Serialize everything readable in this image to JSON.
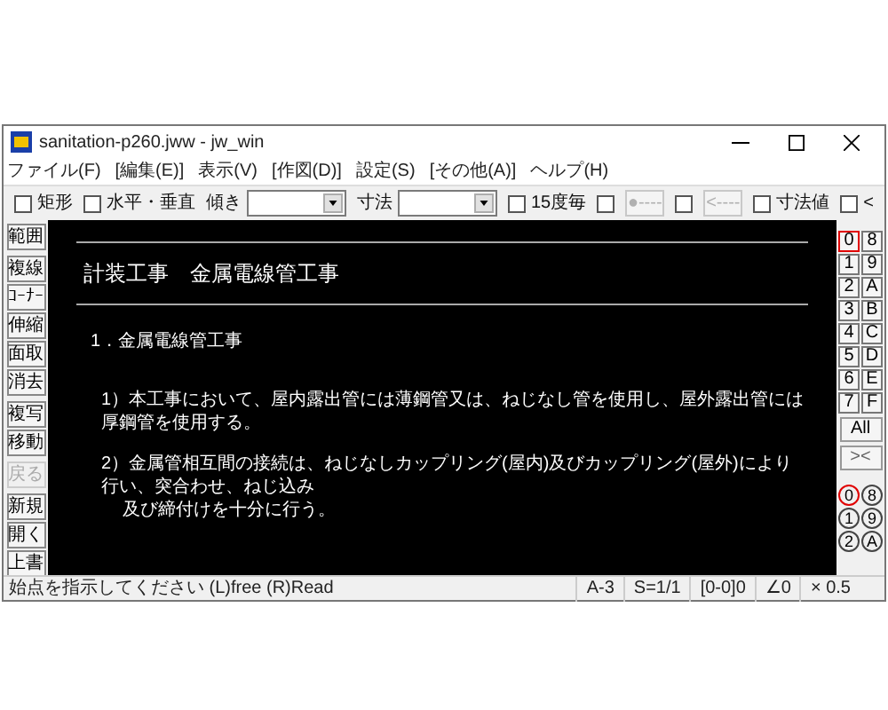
{
  "window": {
    "title": "sanitation-p260.jww - jw_win"
  },
  "menu": [
    "ファイル(F)",
    "[編集(E)]",
    "表示(V)",
    "[作図(D)]",
    "設定(S)",
    "[その他(A)]",
    "ヘルプ(H)"
  ],
  "toolbar": [
    {
      "kind": "checkbox",
      "label": "矩形",
      "checked": false
    },
    {
      "kind": "checkbox",
      "label": "水平・垂直",
      "checked": false
    },
    {
      "kind": "select",
      "label": "傾き"
    },
    {
      "kind": "select",
      "label": "寸法"
    },
    {
      "kind": "checkbox",
      "label": "15度毎",
      "checked": false
    },
    {
      "kind": "checkbox",
      "checked": false
    },
    {
      "kind": "button",
      "label": "●----",
      "disabled": true
    },
    {
      "kind": "checkbox",
      "checked": false
    },
    {
      "kind": "button",
      "label": "<----",
      "disabled": true
    },
    {
      "kind": "checkbox",
      "label": "寸法値",
      "checked": false
    },
    {
      "kind": "checkbox",
      "label": "<",
      "checked": false
    }
  ],
  "left_toolbar": [
    {
      "buttons": [
        {
          "label": "範囲",
          "disabled": false
        }
      ]
    },
    {
      "buttons": [
        {
          "label": "複線",
          "disabled": false
        },
        {
          "label": "ｺｰﾅｰ",
          "disabled": false
        },
        {
          "label": "伸縮",
          "disabled": false
        },
        {
          "label": "面取",
          "disabled": false
        },
        {
          "label": "消去",
          "disabled": false
        }
      ]
    },
    {
      "buttons": [
        {
          "label": "複写",
          "disabled": false
        },
        {
          "label": "移動",
          "disabled": false
        }
      ]
    },
    {
      "buttons": [
        {
          "label": "戻る",
          "disabled": true
        }
      ]
    },
    {
      "buttons": [
        {
          "label": "新規",
          "disabled": false
        },
        {
          "label": "開く",
          "disabled": false
        },
        {
          "label": "上書",
          "disabled": false
        }
      ]
    }
  ],
  "drawing": {
    "title": "計装工事　金属電線管工事",
    "lines": [
      {
        "kind": "heading",
        "text": "1．金属電線管工事"
      },
      {
        "kind": "item",
        "text": "1）本工事において、屋内露出管には薄鋼管又は、ねじなし管を使用し、屋外露出管には厚鋼管を使用する。"
      },
      {
        "kind": "item",
        "text": "2）金属管相互間の接続は、ねじなしカップリング(屋内)及びカップリング(屋外)により行い、突合わせ、ねじ込み"
      },
      {
        "kind": "continuation",
        "text": "及び締付けを十分に行う。"
      }
    ]
  },
  "layer_buttons": [
    {
      "label": "0",
      "selected": true
    },
    {
      "label": "8",
      "selected": false
    },
    {
      "label": "1",
      "selected": false
    },
    {
      "label": "9",
      "selected": false
    },
    {
      "label": "2",
      "selected": false
    },
    {
      "label": "A",
      "selected": false
    },
    {
      "label": "3",
      "selected": false
    },
    {
      "label": "B",
      "selected": false
    },
    {
      "label": "4",
      "selected": false
    },
    {
      "label": "C",
      "selected": false
    },
    {
      "label": "5",
      "selected": false
    },
    {
      "label": "D",
      "selected": false
    },
    {
      "label": "6",
      "selected": false
    },
    {
      "label": "E",
      "selected": false
    },
    {
      "label": "7",
      "selected": false
    },
    {
      "label": "F",
      "selected": false
    }
  ],
  "all_button": "All",
  "cross_button": "><",
  "layer_group_buttons": [
    {
      "label": "0",
      "selected": true
    },
    {
      "label": "8",
      "selected": false
    },
    {
      "label": "1",
      "selected": false
    },
    {
      "label": "9",
      "selected": false
    },
    {
      "label": "2",
      "selected": false
    },
    {
      "label": "A",
      "selected": false
    }
  ],
  "status_bar": {
    "message": "始点を指示してください (L)free (R)Read",
    "fields": [
      "A-3",
      "S=1/1",
      "[0-0]0",
      "∠0",
      "× 0.5"
    ]
  }
}
